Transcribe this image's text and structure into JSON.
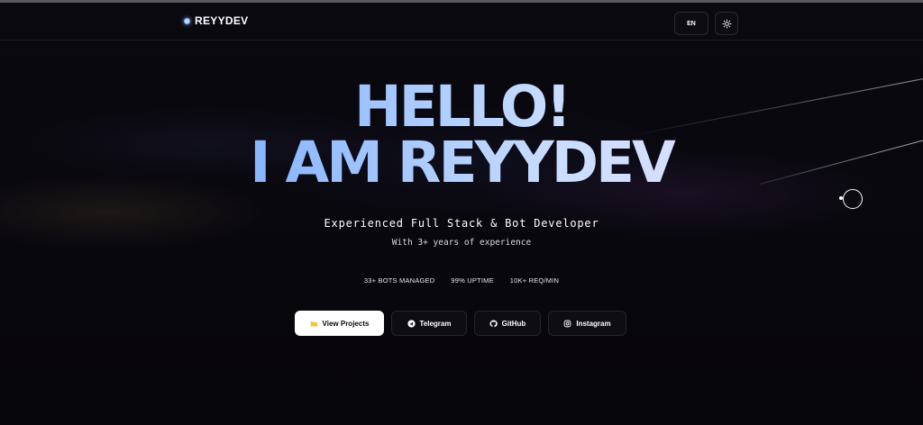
{
  "nav": {
    "brand": "REYYDEV",
    "lang_label": "EN",
    "theme_icon": "sun-icon"
  },
  "hero": {
    "line1": "HELLO!",
    "line2": "I AM REYYDEV",
    "subtitle": "Experienced Full Stack & Bot Developer",
    "tagline": "With 3+ years of experience"
  },
  "stats": [
    {
      "label": "33+ BOTS MANAGED"
    },
    {
      "label": "99% UPTIME"
    },
    {
      "label": "10K+ REQ/MIN"
    }
  ],
  "actions": [
    {
      "label": "View Projects",
      "icon": "folder-icon"
    },
    {
      "label": "Telegram",
      "icon": "telegram-icon"
    },
    {
      "label": "GitHub",
      "icon": "github-icon"
    },
    {
      "label": "Instagram",
      "icon": "instagram-icon"
    }
  ],
  "colors": {
    "background": "#07060b",
    "gradient_start": "#5f9bff",
    "gradient_end": "#f1e6ff",
    "folder": "#f5c542"
  }
}
